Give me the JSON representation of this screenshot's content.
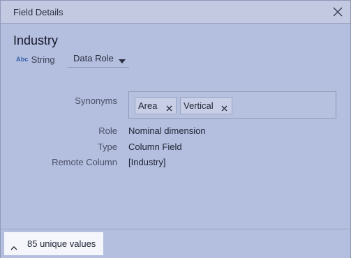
{
  "dialog": {
    "title": "Field Details"
  },
  "field": {
    "name": "Industry",
    "type_icon": "Abc",
    "type_label": "String",
    "role_select": {
      "value": "Data Role"
    }
  },
  "properties": {
    "synonyms_label": "Synonyms",
    "synonyms": [
      "Area",
      "Vertical"
    ],
    "role_label": "Role",
    "role_value": "Nominal dimension",
    "type_label": "Type",
    "type_value": "Column Field",
    "remote_column_label": "Remote Column",
    "remote_column_value": "[Industry]"
  },
  "footer": {
    "unique_values_label": "85 unique values"
  },
  "icons": {
    "close": "close-icon",
    "caret_down": "caret-down-icon",
    "chip_remove": "x-icon",
    "chevron_up": "chevron-up-icon"
  },
  "colors": {
    "background": "#b4bfdf",
    "titlebar": "#c2c9e0",
    "abc_icon": "#2f5da8",
    "highlight": "#f4f6fb"
  }
}
